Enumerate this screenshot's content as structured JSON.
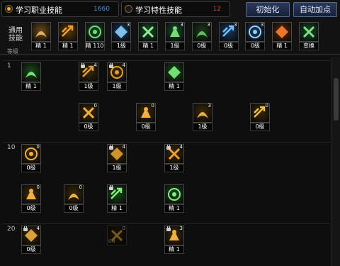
{
  "tabs": [
    {
      "label": "学习职业技能",
      "points": "1660",
      "points_color": "#4f8bdc",
      "selected": true
    },
    {
      "label": "学习特性技能",
      "points": "12",
      "points_color": "#d04040",
      "selected": false
    }
  ],
  "buttons": {
    "reset": "初始化",
    "auto": "自动加点"
  },
  "general": {
    "label": "通用技能",
    "level_label": "等级"
  },
  "level_marks": [
    "1",
    "10",
    "20"
  ],
  "general_skills": [
    {
      "id": "g1",
      "icon": "sitting-figure-icon",
      "sp": "",
      "level": "精 1",
      "color": "#6a4a1a",
      "glyph": "#e0b060"
    },
    {
      "id": "g2",
      "icon": "flame-figure-icon",
      "sp": "",
      "level": "精 1",
      "color": "#5a3a0a",
      "glyph": "#f0a030"
    },
    {
      "id": "g3",
      "icon": "green-arrows-icon",
      "sp": "",
      "level": "精 110",
      "color": "#1a4a2a",
      "glyph": "#70e070"
    },
    {
      "id": "g4",
      "icon": "blue-wings-icon",
      "sp": "3",
      "level": "1级",
      "color": "#1a3a5a",
      "glyph": "#8ad0ff"
    },
    {
      "id": "g5",
      "icon": "green-runner-icon",
      "sp": "",
      "level": "精 1",
      "color": "#1a4a2a",
      "glyph": "#90f090"
    },
    {
      "id": "g6",
      "icon": "green-target-icon",
      "sp": "3",
      "level": "1级",
      "color": "#1a4a2a",
      "glyph": "#70e070"
    },
    {
      "id": "g7",
      "icon": "green-aura-icon",
      "sp": "3",
      "level": "0级",
      "color": "#1a3a1a",
      "glyph": "#60c060"
    },
    {
      "id": "g8",
      "icon": "blue-shield-icon",
      "sp": "3",
      "level": "0级",
      "color": "#1a3a5a",
      "glyph": "#70c0ff"
    },
    {
      "id": "g9",
      "icon": "blue-figure-icon",
      "sp": "3",
      "level": "0级",
      "color": "#1a3a5a",
      "glyph": "#90d0ff"
    },
    {
      "id": "g10",
      "icon": "fire-burst-icon",
      "sp": "",
      "level": "精 1",
      "color": "#5a2a0a",
      "glyph": "#ff8030"
    },
    {
      "id": "g11",
      "icon": "green-swap-icon",
      "sp": "",
      "level": "变换",
      "color": "#1a4a2a",
      "glyph": "#80e080"
    }
  ],
  "tree_skills": [
    {
      "id": "t1",
      "icon": "grab-hand-icon",
      "sp": "",
      "level": "精 1",
      "locked": false,
      "dim": false,
      "on": false,
      "color": "#1a4a1a",
      "glyph": "#70e070"
    },
    {
      "id": "t2",
      "icon": "gold-figure-icon",
      "sp": "4",
      "level": "1级",
      "locked": true,
      "dim": false,
      "on": false,
      "color": "#3a2a0a",
      "glyph": "#e0a030"
    },
    {
      "id": "t3",
      "icon": "gold-slash-icon",
      "sp": "4",
      "level": "1级",
      "locked": true,
      "dim": false,
      "on": false,
      "color": "#3a2a0a",
      "glyph": "#e0a030"
    },
    {
      "id": "t4",
      "icon": "green-kick-icon",
      "sp": "",
      "level": "精 1",
      "locked": false,
      "dim": false,
      "on": false,
      "color": "#1a4a1a",
      "glyph": "#80f080"
    },
    {
      "id": "t5",
      "icon": "gold-burst-icon",
      "sp": "0",
      "level": "0级",
      "locked": false,
      "dim": false,
      "on": false,
      "color": "#3a2a0a",
      "glyph": "#f0b040"
    },
    {
      "id": "t6",
      "icon": "gold-arrows-icon",
      "sp": "0",
      "level": "0级",
      "locked": false,
      "dim": false,
      "on": false,
      "color": "#3a2a0a",
      "glyph": "#f0b040"
    },
    {
      "id": "t7",
      "icon": "gold-wave-icon",
      "sp": "3",
      "level": "1级",
      "locked": false,
      "dim": false,
      "on": false,
      "color": "#3a2a0a",
      "glyph": "#f0b040"
    },
    {
      "id": "t8",
      "icon": "gold-cross-shield-icon",
      "sp": "0",
      "level": "0级",
      "locked": false,
      "dim": false,
      "on": false,
      "color": "#3a2a0a",
      "glyph": "#f0c040"
    },
    {
      "id": "t9",
      "icon": "gold-claw-icon",
      "sp": "0",
      "level": "0级",
      "locked": false,
      "dim": false,
      "on": false,
      "color": "#3a2a0a",
      "glyph": "#f0b040"
    },
    {
      "id": "t10",
      "icon": "gold-ring-icon",
      "sp": "4",
      "level": "1级",
      "locked": true,
      "dim": false,
      "on": false,
      "color": "#3a2a0a",
      "glyph": "#e0a030"
    },
    {
      "id": "t11",
      "icon": "gold-flame-icon",
      "sp": "4",
      "level": "1级",
      "locked": true,
      "dim": false,
      "on": false,
      "color": "#3a2a0a",
      "glyph": "#f0a030"
    },
    {
      "id": "t12",
      "icon": "gold-spread-icon",
      "sp": "0",
      "level": "0级",
      "locked": false,
      "dim": false,
      "on": false,
      "color": "#3a2a0a",
      "glyph": "#f0b040"
    },
    {
      "id": "t13",
      "icon": "gold-dash-icon",
      "sp": "0",
      "level": "0级",
      "locked": false,
      "dim": false,
      "on": false,
      "color": "#3a2a0a",
      "glyph": "#f0b040"
    },
    {
      "id": "t14",
      "icon": "green-blade-icon",
      "sp": "",
      "level": "精 1",
      "locked": true,
      "dim": false,
      "on": false,
      "color": "#1a4a1a",
      "glyph": "#80f080"
    },
    {
      "id": "t15",
      "icon": "green-tree-icon",
      "sp": "",
      "level": "精 1",
      "locked": false,
      "dim": false,
      "on": false,
      "color": "#1a4a1a",
      "glyph": "#80f080"
    },
    {
      "id": "t16",
      "icon": "gold-pillar-icon",
      "sp": "4",
      "level": "0级",
      "locked": true,
      "dim": false,
      "on": false,
      "color": "#3a2a0a",
      "glyph": "#f0b040"
    },
    {
      "id": "t17",
      "icon": "gold-spin-icon",
      "sp": "0",
      "level": "",
      "locked": false,
      "dim": true,
      "on": true,
      "color": "#3a2a0a",
      "glyph": "#f0b040"
    },
    {
      "id": "t18",
      "icon": "gold-figure-icon",
      "sp": "3",
      "level": "精 1",
      "locked": true,
      "dim": false,
      "on": false,
      "color": "#3a2a0a",
      "glyph": "#f0b040"
    }
  ]
}
